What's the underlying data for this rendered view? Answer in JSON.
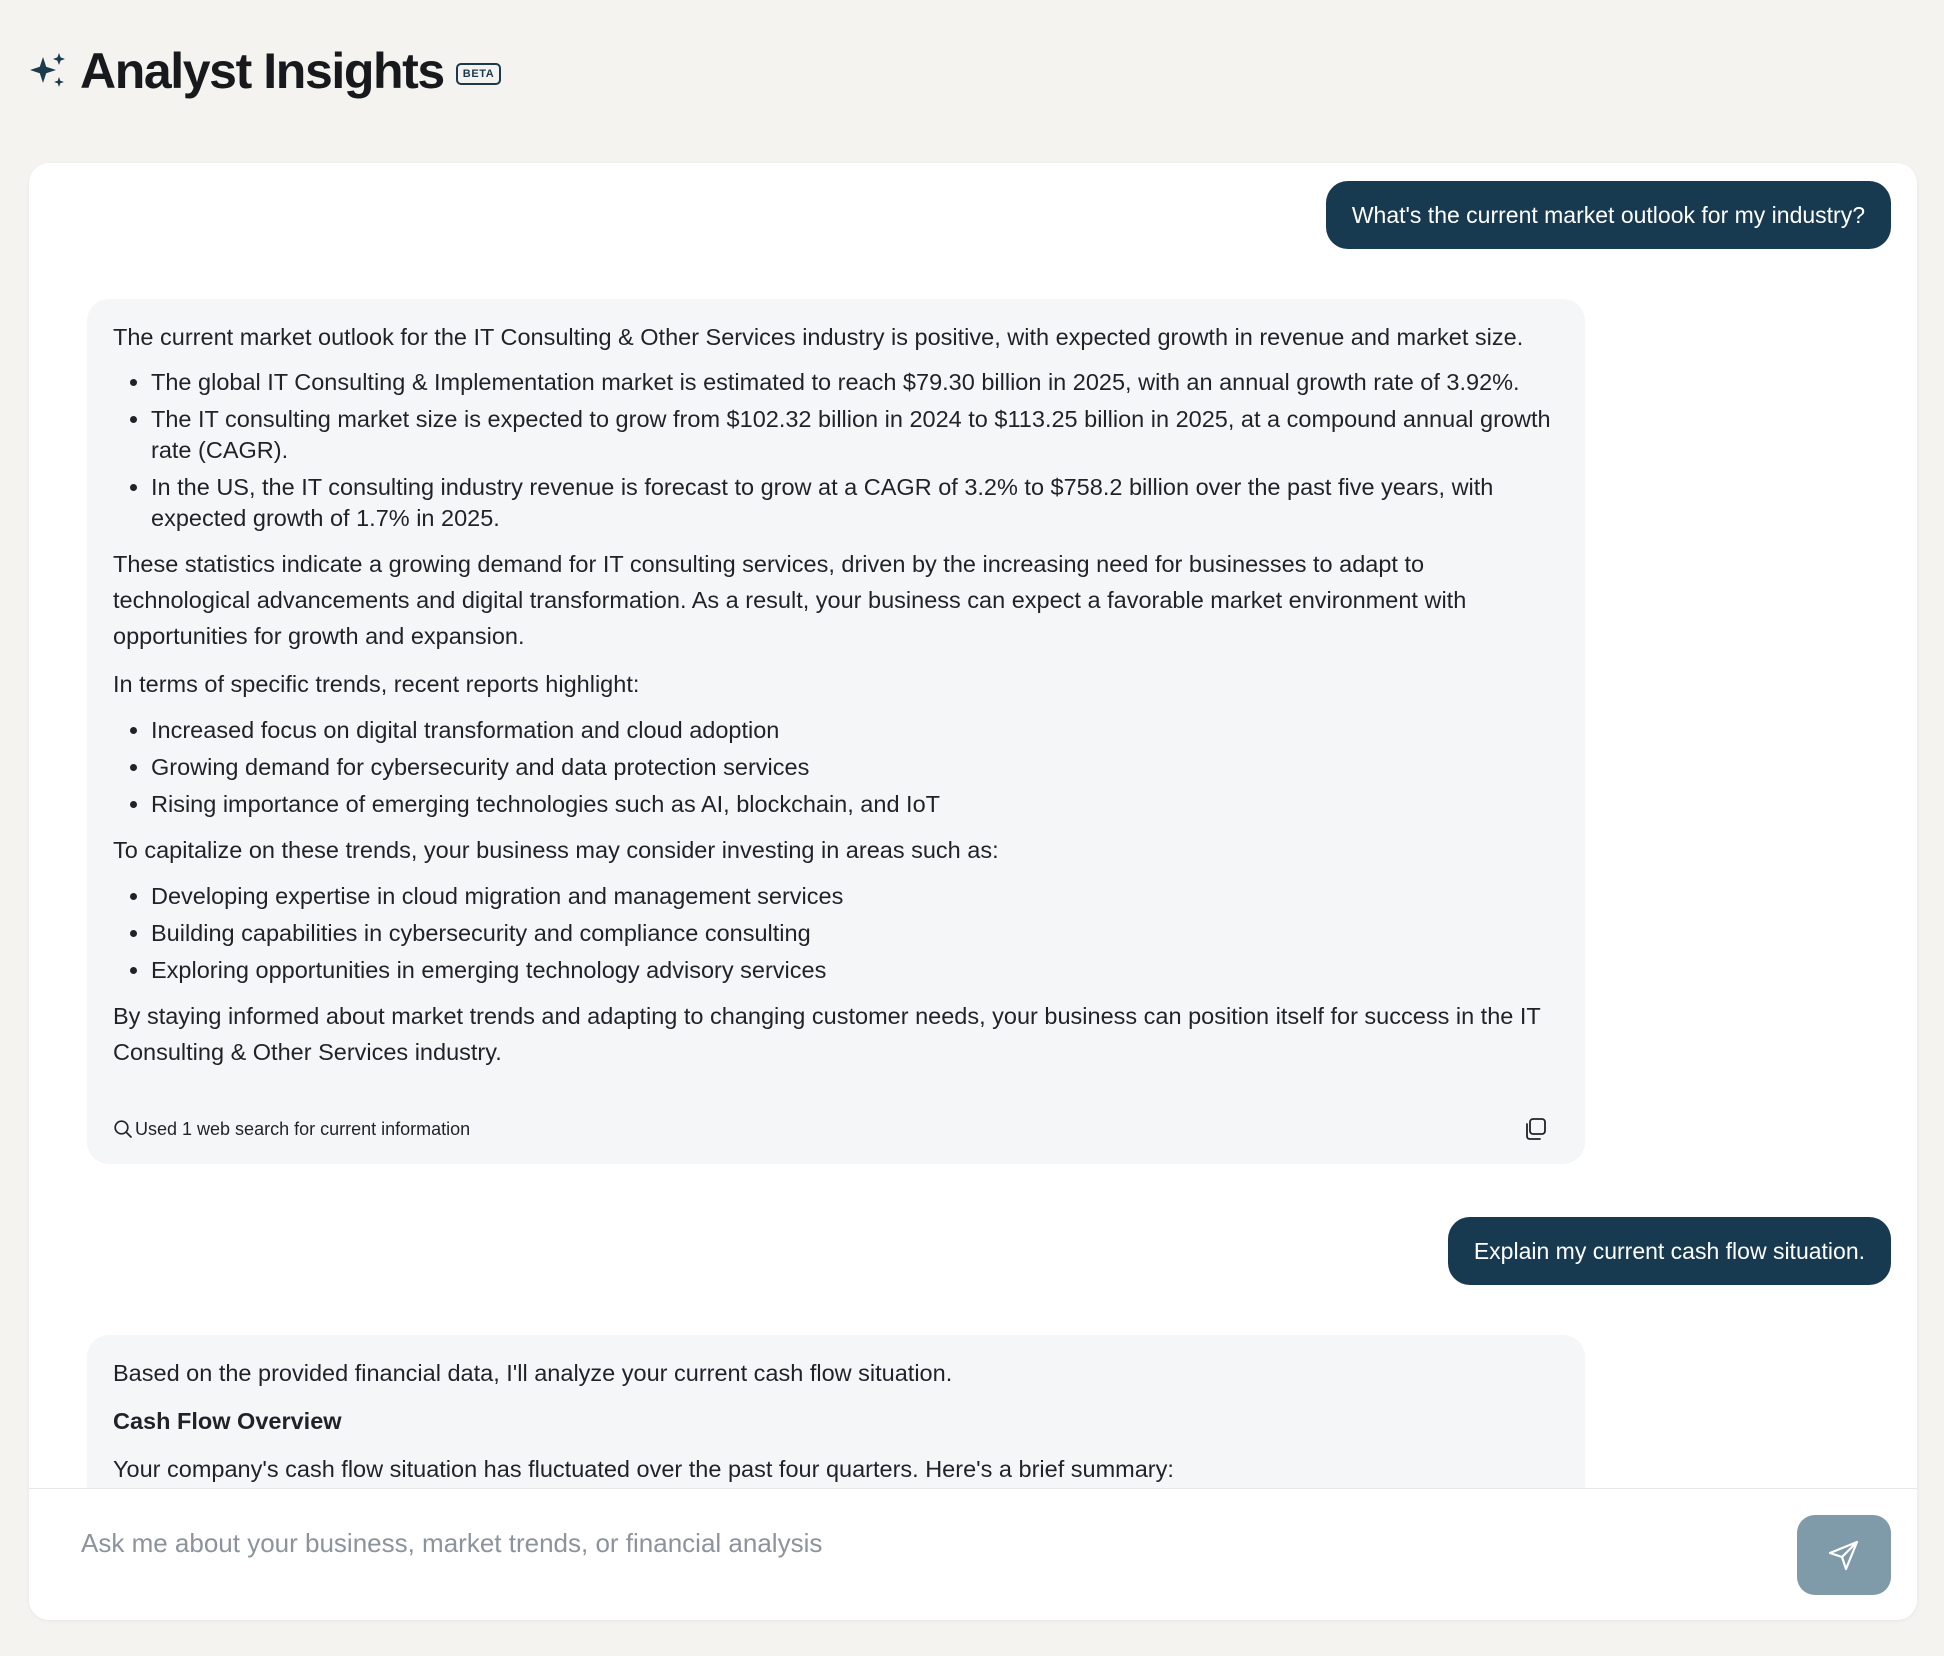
{
  "app": {
    "title": "Analyst Insights",
    "badge": "BETA",
    "logo_icon": "sparkles-icon"
  },
  "conversation": [
    {
      "role": "user",
      "text": "What's the current market outlook for my industry?"
    },
    {
      "role": "assistant",
      "intro": "The current market outlook for the IT Consulting & Other Services industry is positive, with expected growth in revenue and market size.",
      "stats": [
        "The global IT Consulting & Implementation market is estimated to reach $79.30 billion in 2025, with an annual growth rate of 3.92%.",
        "The IT consulting market size is expected to grow from $102.32 billion in 2024 to $113.25 billion in 2025, at a compound annual growth rate (CAGR).",
        "In the US, the IT consulting industry revenue is forecast to grow at a CAGR of 3.2% to $758.2 billion over the past five years, with expected growth of 1.7% in 2025."
      ],
      "para2": "These statistics indicate a growing demand for IT consulting services, driven by the increasing need for businesses to adapt to technological advancements and digital transformation. As a result, your business can expect a favorable market environment with opportunities for growth and expansion.",
      "trends_intro": "In terms of specific trends, recent reports highlight:",
      "trends": [
        "Increased focus on digital transformation and cloud adoption",
        "Growing demand for cybersecurity and data protection services",
        "Rising importance of emerging technologies such as AI, blockchain, and IoT"
      ],
      "invest_intro": "To capitalize on these trends, your business may consider investing in areas such as:",
      "invest": [
        "Developing expertise in cloud migration and management services",
        "Building capabilities in cybersecurity and compliance consulting",
        "Exploring opportunities in emerging technology advisory services"
      ],
      "conclusion": "By staying informed about market trends and adapting to changing customer needs, your business can position itself for success in the IT Consulting & Other Services industry.",
      "footer_note": "Used 1 web search for current information",
      "footer_icon": "search-icon",
      "copy_icon": "copy-icon"
    },
    {
      "role": "user",
      "text": "Explain my current cash flow situation."
    },
    {
      "role": "assistant",
      "intro": "Based on the provided financial data, I'll analyze your current cash flow situation.",
      "heading": "Cash Flow Overview",
      "summary": "Your company's cash flow situation has fluctuated over the past four quarters. Here's a brief summary:"
    }
  ],
  "composer": {
    "placeholder": "Ask me about your business, market trends, or financial analysis",
    "send_icon": "send-icon"
  },
  "colors": {
    "page_bg": "#f4f3f0",
    "user_bubble": "#173a50",
    "assistant_card": "#f5f6f8",
    "send_button": "#7f9aa8"
  }
}
